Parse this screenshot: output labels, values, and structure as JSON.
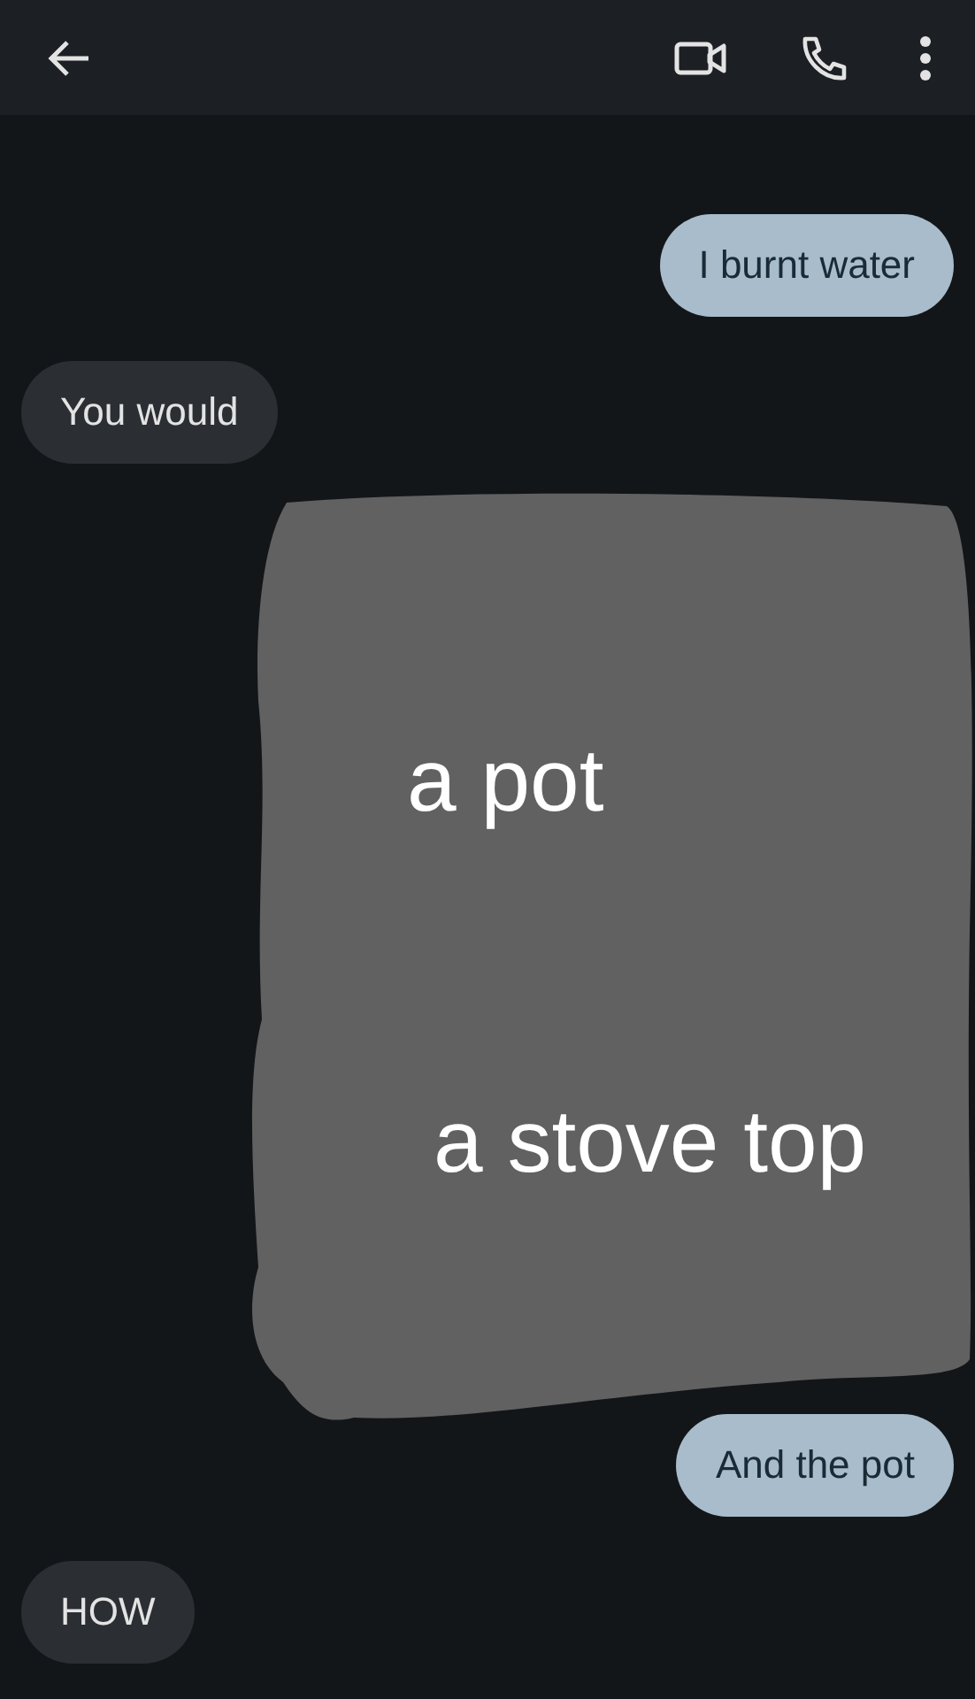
{
  "messages_top": [
    {
      "text": "I burnt water",
      "kind": "sent"
    },
    {
      "text": "You would",
      "kind": "received"
    }
  ],
  "messages_bottom": [
    {
      "text": "And the pot",
      "kind": "sent"
    },
    {
      "text": "HOW",
      "kind": "received"
    }
  ],
  "overlay": {
    "kind": "scribble",
    "texts": [
      "a pot",
      "a stove top"
    ]
  }
}
